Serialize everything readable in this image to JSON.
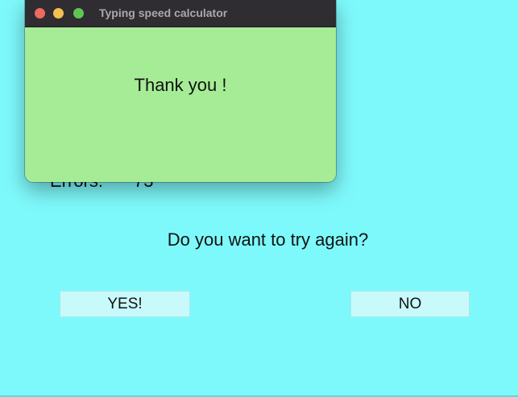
{
  "window": {
    "title": "Typing speed calculator"
  },
  "popup": {
    "message": "Thank you !"
  },
  "main": {
    "errors_label": "Errors:",
    "errors_value": "73",
    "question": "Do you want to try again?",
    "yes_label": "YES!",
    "no_label": "NO"
  },
  "colors": {
    "background": "#7ef9fb",
    "popup_background": "#a6ec96",
    "titlebar": "#2f2d31",
    "button_background": "#c8f9fb",
    "close_light": "#ed6a5e",
    "minimize_light": "#f5bf4f",
    "zoom_light": "#61c554"
  },
  "icons": {
    "close": "close-light-icon",
    "minimize": "minimize-light-icon",
    "zoom": "zoom-light-icon"
  }
}
